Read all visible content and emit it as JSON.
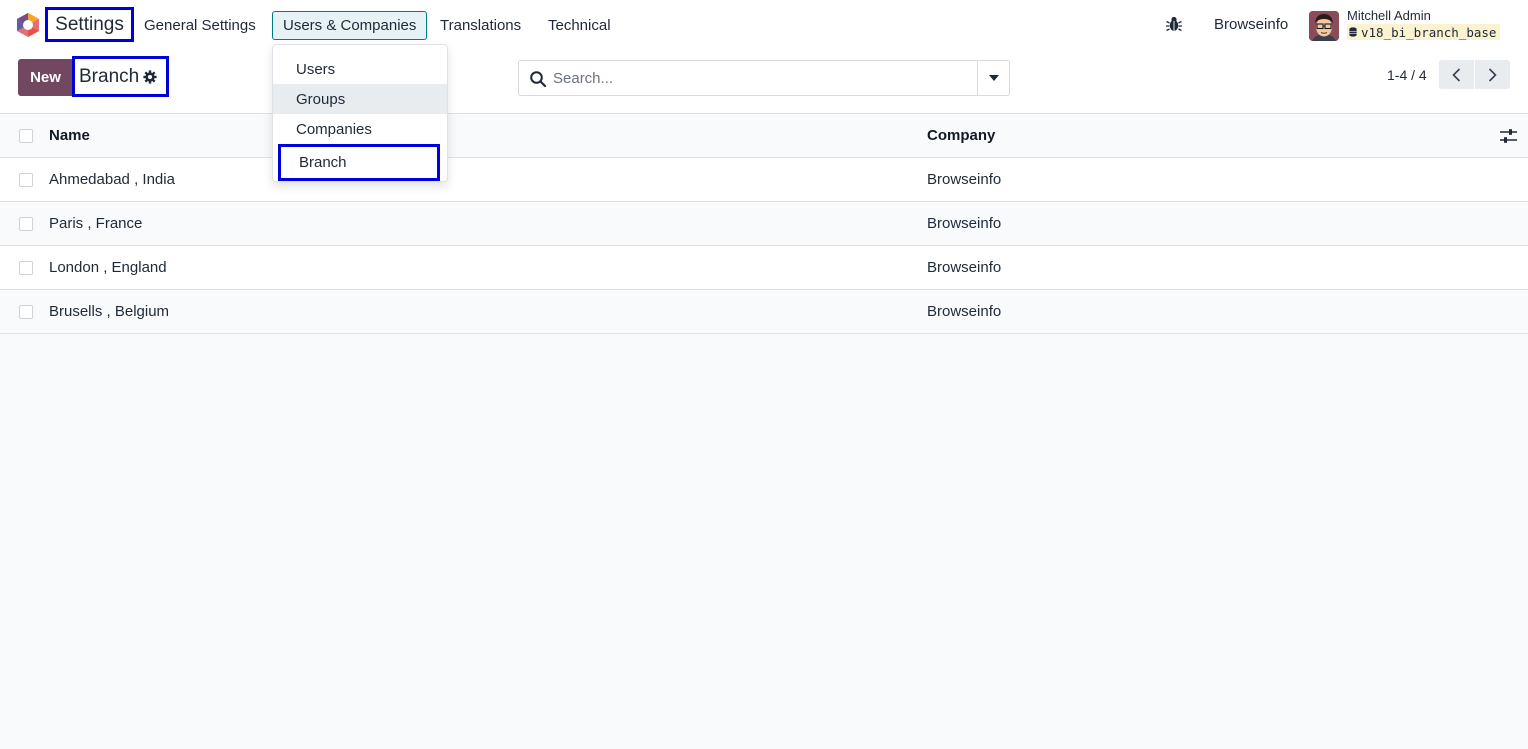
{
  "navbar": {
    "app_title": "Settings",
    "menu": [
      {
        "label": "General Settings"
      },
      {
        "label": "Users & Companies"
      },
      {
        "label": "Translations"
      },
      {
        "label": "Technical"
      }
    ],
    "company": "Browseinfo",
    "user_name": "Mitchell Admin",
    "database": "v18_bi_branch_base"
  },
  "dropdown": {
    "items": [
      {
        "label": "Users"
      },
      {
        "label": "Groups"
      },
      {
        "label": "Companies"
      },
      {
        "label": "Branch"
      }
    ]
  },
  "control_panel": {
    "new_label": "New",
    "breadcrumb": "Branch",
    "search_placeholder": "Search...",
    "pager": "1-4 / 4"
  },
  "list": {
    "columns": {
      "name": "Name",
      "company": "Company"
    },
    "rows": [
      {
        "name": "Ahmedabad , India",
        "company": "Browseinfo"
      },
      {
        "name": "Paris , France",
        "company": "Browseinfo"
      },
      {
        "name": "London , England",
        "company": "Browseinfo"
      },
      {
        "name": "Brusells , Belgium",
        "company": "Browseinfo"
      }
    ]
  },
  "colors": {
    "brand": "#71485f",
    "active_menu": "#017e84",
    "highlight_box": "#0000dd"
  }
}
